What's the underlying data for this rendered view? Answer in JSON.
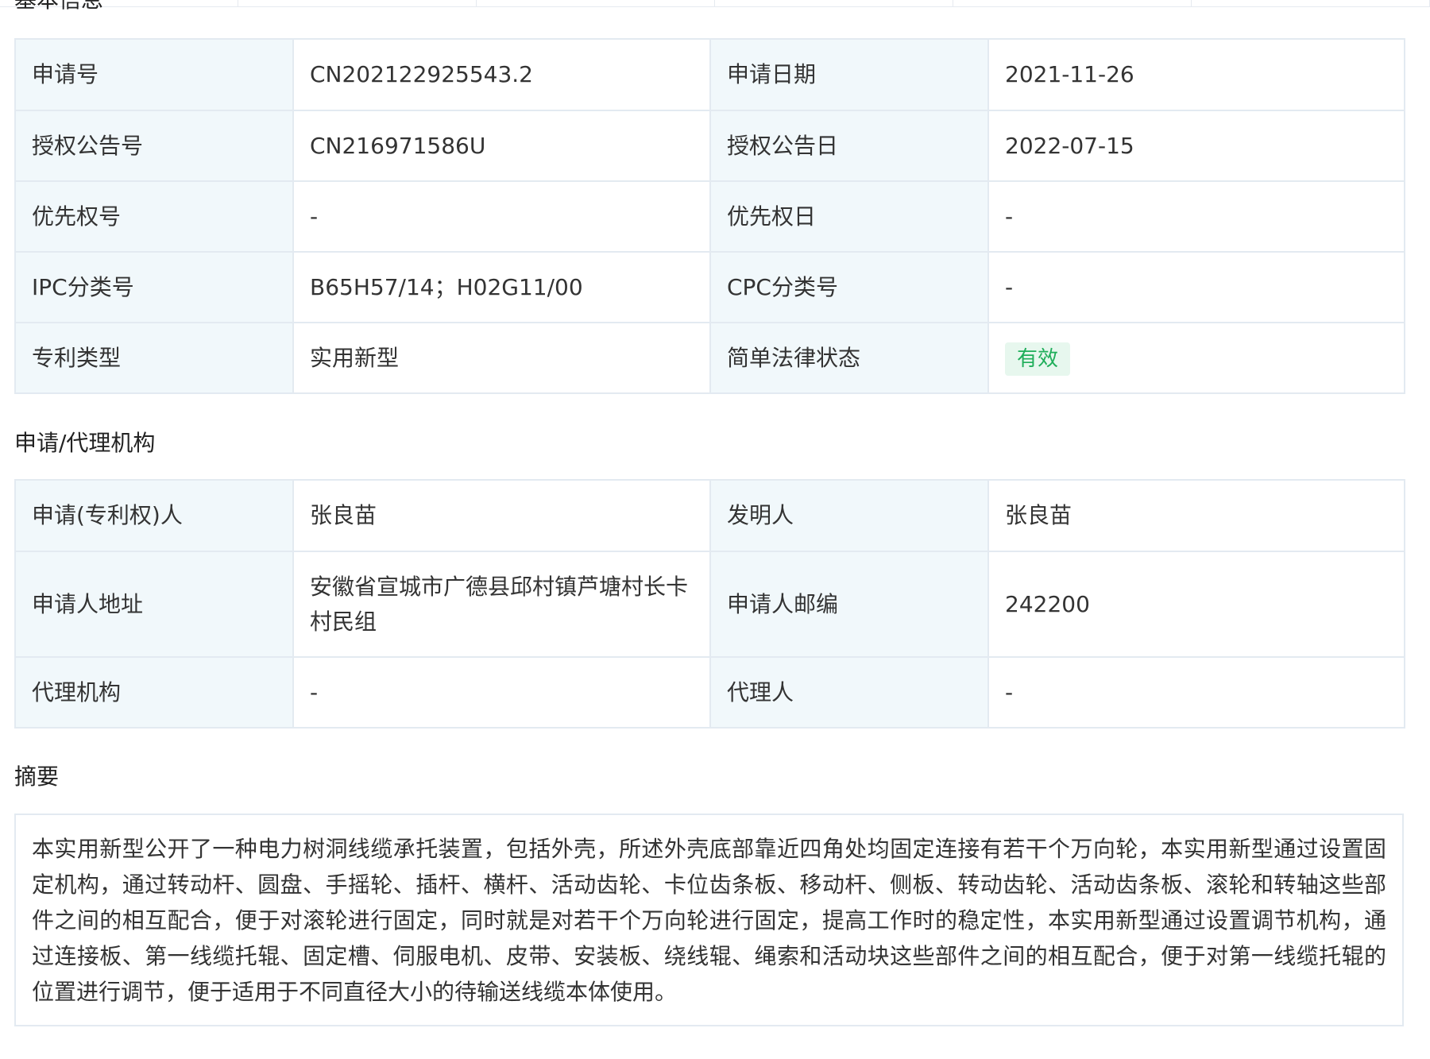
{
  "top_section": {
    "title": "基本信息"
  },
  "basic_info": {
    "rows": [
      {
        "label1": "申请号",
        "value1": "CN202122925543.2",
        "label2": "申请日期",
        "value2": "2021-11-26"
      },
      {
        "label1": "授权公告号",
        "value1": "CN216971586U",
        "label2": "授权公告日",
        "value2": "2022-07-15"
      },
      {
        "label1": "优先权号",
        "value1": "-",
        "label2": "优先权日",
        "value2": "-"
      },
      {
        "label1": "IPC分类号",
        "value1": "B65H57/14；H02G11/00",
        "label2": "CPC分类号",
        "value2": "-"
      },
      {
        "label1": "专利类型",
        "value1": "实用新型",
        "label2": "简单法律状态",
        "value2": "有效"
      }
    ]
  },
  "applicant_section": {
    "title": "申请/代理机构",
    "rows": [
      {
        "label1": "申请(专利权)人",
        "value1": "张良苗",
        "label2": "发明人",
        "value2": "张良苗"
      },
      {
        "label1": "申请人地址",
        "value1": "安徽省宣城市广德县邱村镇芦塘村长卡村民组",
        "label2": "申请人邮编",
        "value2": "242200"
      },
      {
        "label1": "代理机构",
        "value1": "-",
        "label2": "代理人",
        "value2": "-"
      }
    ]
  },
  "abstract_section": {
    "title": "摘要",
    "text": "本实用新型公开了一种电力树洞线缆承托装置，包括外壳，所述外壳底部靠近四角处均固定连接有若干个万向轮，本实用新型通过设置固定机构，通过转动杆、圆盘、手摇轮、插杆、横杆、活动齿轮、卡位齿条板、移动杆、侧板、转动齿轮、活动齿条板、滚轮和转轴这些部件之间的相互配合，便于对滚轮进行固定，同时就是对若干个万向轮进行固定，提高工作时的稳定性，本实用新型通过设置调节机构，通过连接板、第一线缆托辊、固定槽、伺服电机、皮带、安装板、绕线辊、绳索和活动块这些部件之间的相互配合，便于对第一线缆托辊的位置进行调节，便于适用于不同直径大小的待输送线缆本体使用。"
  },
  "colors": {
    "label_bg": "#f1f8fb",
    "border": "#e3eaf1",
    "status_text": "#1fae5a",
    "status_bg": "#e7f7ee"
  }
}
